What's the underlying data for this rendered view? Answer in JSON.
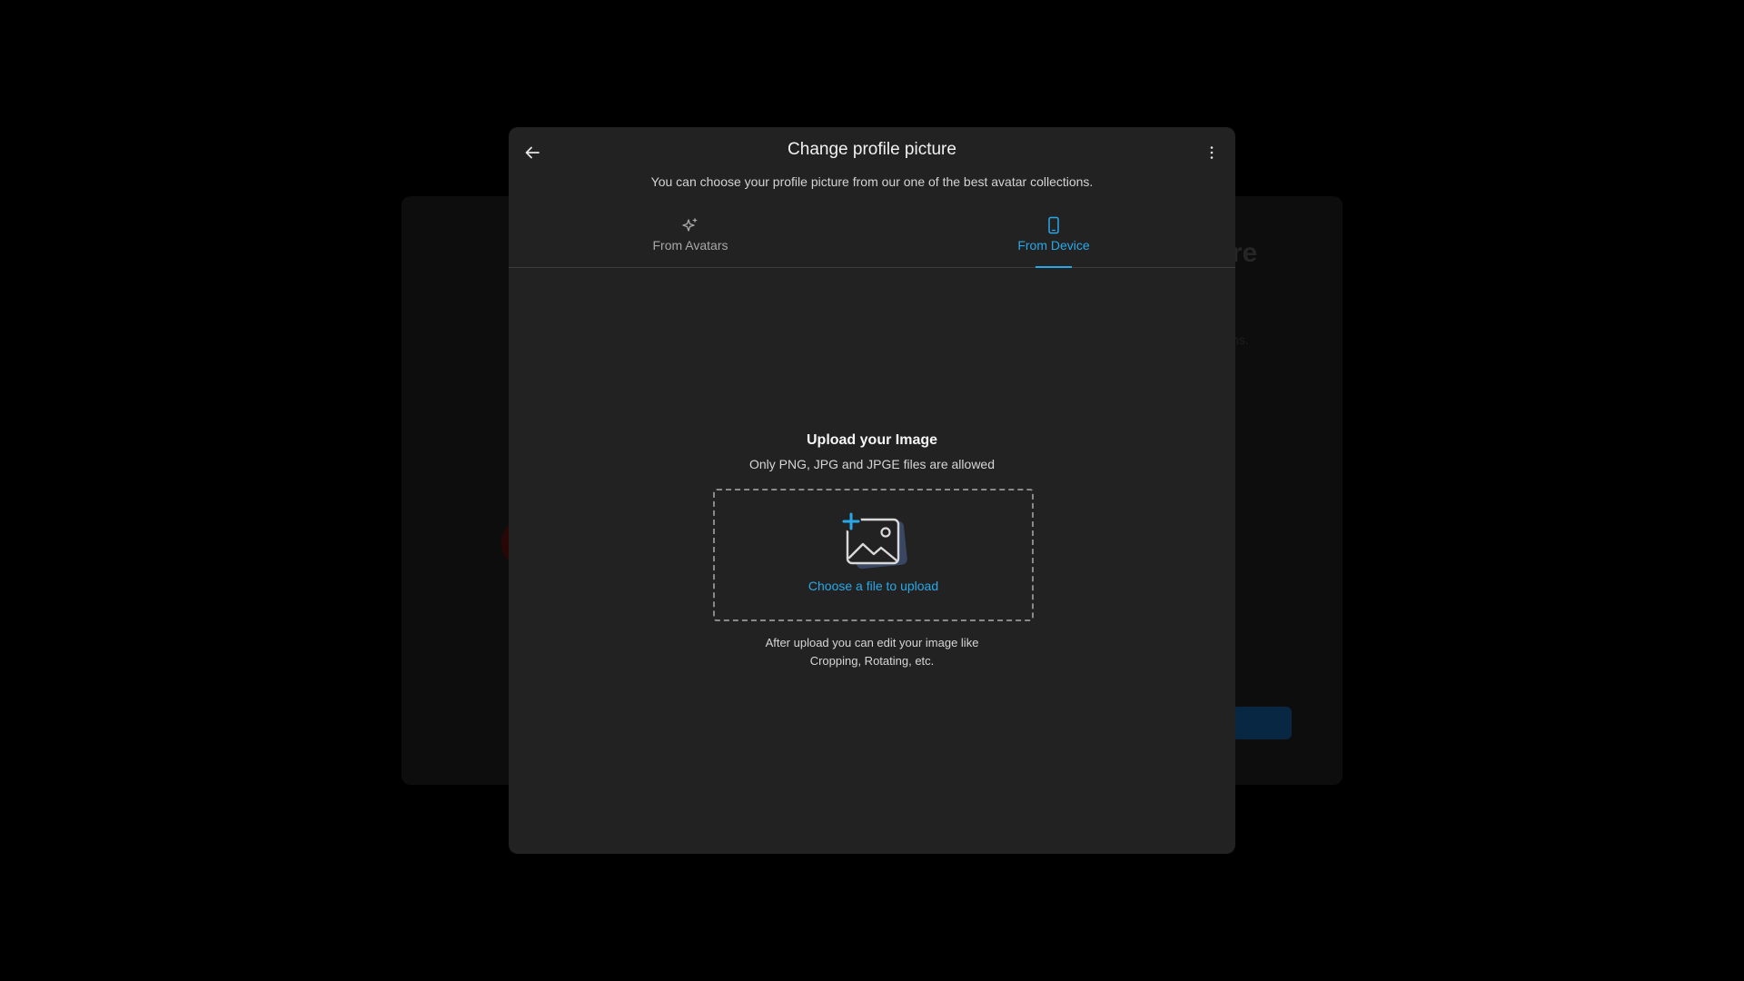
{
  "dialog": {
    "title": "Change profile picture",
    "subtitle": "You can choose your profile picture from our one of the best avatar collections.",
    "back_icon": "arrow-left-icon",
    "menu_icon": "more-vertical-icon"
  },
  "tabs": [
    {
      "label": "From Avatars",
      "icon": "sparkles-icon",
      "active": false
    },
    {
      "label": "From Device",
      "icon": "smartphone-icon",
      "active": true
    }
  ],
  "upload": {
    "title": "Upload your Image",
    "subtitle": "Only PNG, JPG and JPGE files are allowed",
    "choose_label": "Choose a file to upload",
    "note_line1": "After upload you can edit your image like",
    "note_line2": "Cropping, Rotating, etc.",
    "illustration_icon": "image-add-icon"
  },
  "colors": {
    "accent": "#29a8e8",
    "dialog_bg": "#222223",
    "overlay_bg": "#000000"
  }
}
